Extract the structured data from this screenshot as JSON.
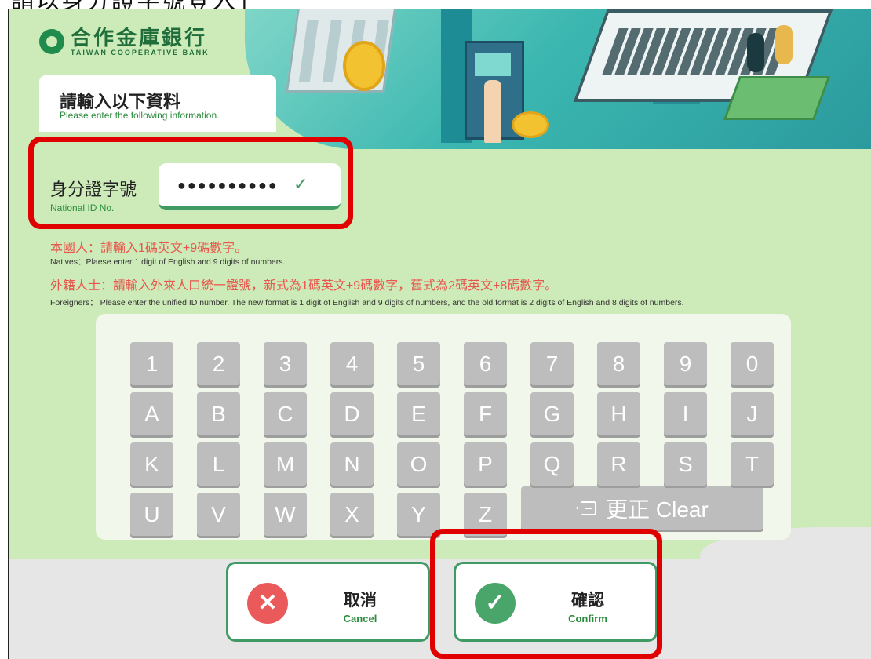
{
  "caption": "請以身分證字號登入」",
  "brand": {
    "name_zh": "合作金庫銀行",
    "name_en": "TAIWAN COOPERATIVE BANK"
  },
  "title": {
    "zh": "請輸入以下資料",
    "en": "Please enter the following information."
  },
  "id_field": {
    "label_zh": "身分證字號",
    "label_en": "National ID No.",
    "masked_value": "●●●●●●●●●●"
  },
  "instructions": {
    "natives_zh": "本國人：請輸入1碼英文+9碼數字。",
    "natives_en": "Natives：Plaese enter 1 digit of English and 9 digits of numbers.",
    "foreigners_zh": "外籍人士：請輸入外來人口統一證號，新式為1碼英文+9碼數字，舊式為2碼英文+8碼數字。",
    "foreigners_en": "Foreigners： Please enter the unified ID number. The new format is 1 digit of English and 9 digits of numbers, and the old format is 2 digits of English and 8 digits of numbers."
  },
  "keypad": {
    "rows": [
      [
        "1",
        "2",
        "3",
        "4",
        "5",
        "6",
        "7",
        "8",
        "9",
        "0"
      ],
      [
        "A",
        "B",
        "C",
        "D",
        "E",
        "F",
        "G",
        "H",
        "I",
        "J"
      ],
      [
        "K",
        "L",
        "M",
        "N",
        "O",
        "P",
        "Q",
        "R",
        "S",
        "T"
      ],
      [
        "U",
        "V",
        "W",
        "X",
        "Y",
        "Z"
      ]
    ],
    "clear_label": "更正 Clear"
  },
  "actions": {
    "cancel_zh": "取消",
    "cancel_en": "Cancel",
    "confirm_zh": "確認",
    "confirm_en": "Confirm"
  },
  "colors": {
    "panel_green": "#cdebb8",
    "accent_green": "#3f9a64",
    "instruction_red": "#e8554c",
    "highlight_red": "#e00000",
    "key_gray": "#bdbdbd"
  },
  "icons": {
    "clear": "backspace-icon",
    "cancel": "close-icon",
    "confirm": "check-icon",
    "field_check": "check-icon"
  }
}
